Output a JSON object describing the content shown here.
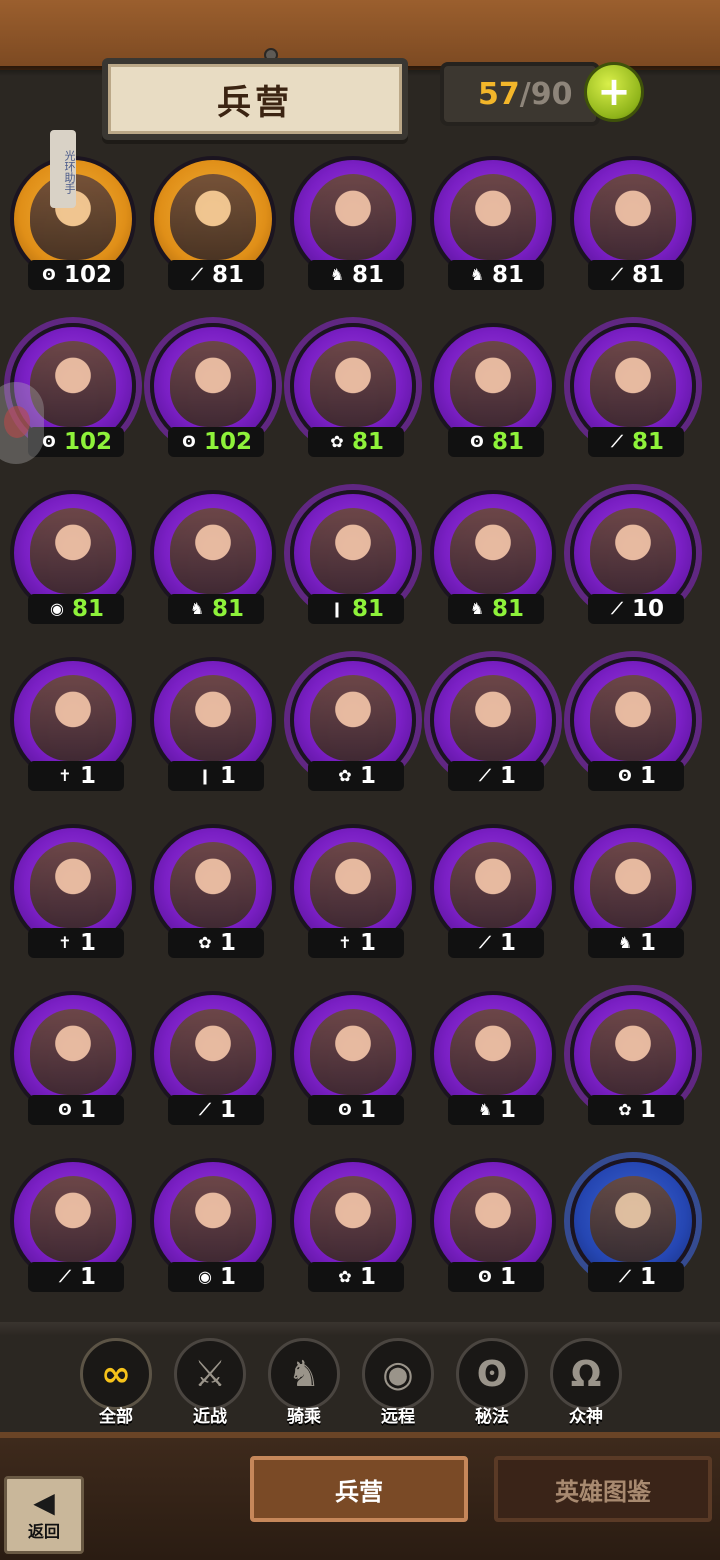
{
  "header": {
    "title": "兵营",
    "count_current": "57",
    "count_separator": "/",
    "count_max": "90",
    "add_label": "+",
    "aura_tag": "光环助手"
  },
  "heroes": [
    {
      "cls": "ʘ",
      "level": "102",
      "green": false,
      "tone": "gold"
    },
    {
      "cls": "⟋",
      "level": "81",
      "green": false,
      "tone": "gold"
    },
    {
      "cls": "♞",
      "level": "81",
      "green": false,
      "tone": "purple"
    },
    {
      "cls": "♞",
      "level": "81",
      "green": false,
      "tone": "purple"
    },
    {
      "cls": "⟋",
      "level": "81",
      "green": false,
      "tone": "purple"
    },
    {
      "cls": "ʘ",
      "level": "102",
      "green": true,
      "tone": "purple",
      "spiky": true
    },
    {
      "cls": "ʘ",
      "level": "102",
      "green": true,
      "tone": "purple",
      "spiky": true
    },
    {
      "cls": "✿",
      "level": "81",
      "green": true,
      "tone": "purple",
      "spiky": true
    },
    {
      "cls": "ʘ",
      "level": "81",
      "green": true,
      "tone": "purple"
    },
    {
      "cls": "⟋",
      "level": "81",
      "green": true,
      "tone": "purple",
      "spiky": true
    },
    {
      "cls": "◉",
      "level": "81",
      "green": true,
      "tone": "purple"
    },
    {
      "cls": "♞",
      "level": "81",
      "green": true,
      "tone": "purple"
    },
    {
      "cls": "ǀ",
      "level": "81",
      "green": true,
      "tone": "purple",
      "spiky": true
    },
    {
      "cls": "♞",
      "level": "81",
      "green": true,
      "tone": "purple"
    },
    {
      "cls": "⟋",
      "level": "10",
      "green": false,
      "tone": "purple",
      "spiky": true
    },
    {
      "cls": "✝",
      "level": "1",
      "green": false,
      "tone": "purple"
    },
    {
      "cls": "ǀ",
      "level": "1",
      "green": false,
      "tone": "purple"
    },
    {
      "cls": "✿",
      "level": "1",
      "green": false,
      "tone": "purple",
      "spiky": true
    },
    {
      "cls": "⟋",
      "level": "1",
      "green": false,
      "tone": "purple",
      "spiky": true
    },
    {
      "cls": "ʘ",
      "level": "1",
      "green": false,
      "tone": "purple",
      "spiky": true
    },
    {
      "cls": "✝",
      "level": "1",
      "green": false,
      "tone": "purple"
    },
    {
      "cls": "✿",
      "level": "1",
      "green": false,
      "tone": "purple"
    },
    {
      "cls": "✝",
      "level": "1",
      "green": false,
      "tone": "purple"
    },
    {
      "cls": "⟋",
      "level": "1",
      "green": false,
      "tone": "purple"
    },
    {
      "cls": "♞",
      "level": "1",
      "green": false,
      "tone": "purple"
    },
    {
      "cls": "ʘ",
      "level": "1",
      "green": false,
      "tone": "purple"
    },
    {
      "cls": "⟋",
      "level": "1",
      "green": false,
      "tone": "purple"
    },
    {
      "cls": "ʘ",
      "level": "1",
      "green": false,
      "tone": "purple"
    },
    {
      "cls": "♞",
      "level": "1",
      "green": false,
      "tone": "purple"
    },
    {
      "cls": "✿",
      "level": "1",
      "green": false,
      "tone": "purple",
      "spiky": true
    },
    {
      "cls": "⟋",
      "level": "1",
      "green": false,
      "tone": "purple"
    },
    {
      "cls": "◉",
      "level": "1",
      "green": false,
      "tone": "purple"
    },
    {
      "cls": "✿",
      "level": "1",
      "green": false,
      "tone": "purple"
    },
    {
      "cls": "ʘ",
      "level": "1",
      "green": false,
      "tone": "purple"
    },
    {
      "cls": "⟋",
      "level": "1",
      "green": false,
      "tone": "blue",
      "spiky": true
    }
  ],
  "filters": [
    {
      "icon": "∞",
      "label": "全部",
      "active": true,
      "name": "filter-all"
    },
    {
      "icon": "⚔",
      "label": "近战",
      "active": false,
      "name": "filter-melee"
    },
    {
      "icon": "♞",
      "label": "骑乘",
      "active": false,
      "name": "filter-mounted"
    },
    {
      "icon": "◉",
      "label": "远程",
      "active": false,
      "name": "filter-ranged"
    },
    {
      "icon": "ʘ",
      "label": "秘法",
      "active": false,
      "name": "filter-arcane"
    },
    {
      "icon": "Ω",
      "label": "众神",
      "active": false,
      "name": "filter-gods"
    }
  ],
  "tabs": {
    "barracks": "兵营",
    "codex": "英雄图鉴"
  },
  "back": {
    "icon": "◀",
    "label": "返回"
  },
  "colors": {
    "level_green": "#8ef23a",
    "count_gold": "#f3b62a",
    "badge_purple": "#7a1fc4",
    "badge_gold": "#e08f18",
    "badge_blue": "#2546b2"
  }
}
